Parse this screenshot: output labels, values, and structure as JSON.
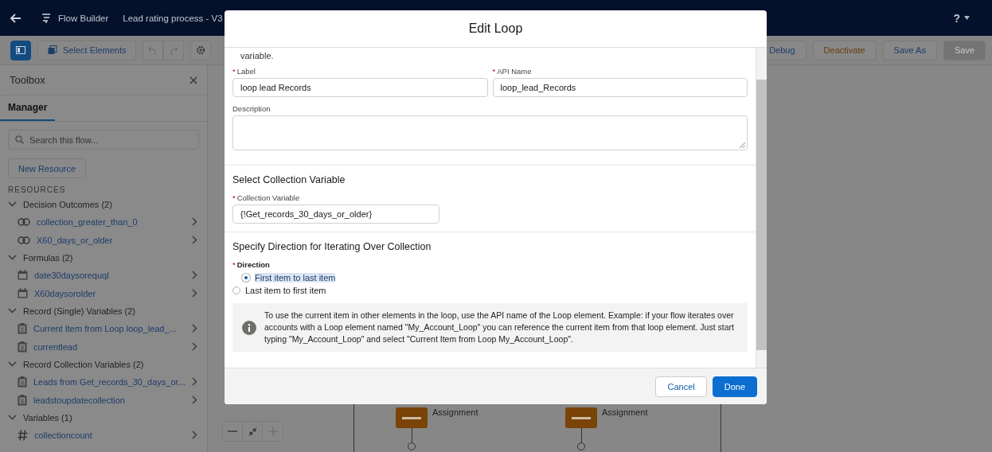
{
  "header": {
    "app_title": "Flow Builder",
    "flow_name": "Lead rating process - V3",
    "help": "?"
  },
  "toolbar": {
    "select_elements": "Select Elements",
    "buttons": [
      {
        "label": "Debug",
        "kind": "normal",
        "disabled": false
      },
      {
        "label": "Deactivate",
        "kind": "warning",
        "disabled": false
      },
      {
        "label": "Save As",
        "kind": "normal",
        "disabled": false
      },
      {
        "label": "Save",
        "kind": "normal",
        "disabled": true
      }
    ]
  },
  "toolbox": {
    "title": "Toolbox",
    "tabs": [
      {
        "label": "Manager",
        "selected": true
      }
    ],
    "search": {
      "placeholder": "Search this flow..."
    },
    "new_resource": "New Resource",
    "section_heading": "RESOURCES",
    "groups": [
      {
        "label": "Decision Outcomes (2)",
        "expanded": true,
        "children": [
          {
            "label": "collection_greater_than_0",
            "kind": "outcome"
          },
          {
            "label": "X60_days_or_older",
            "kind": "outcome"
          }
        ]
      },
      {
        "label": "Formulas (2)",
        "expanded": true,
        "children": [
          {
            "label": "date30daysorequql",
            "kind": "formula"
          },
          {
            "label": "X60daysorolder",
            "kind": "formula"
          }
        ]
      },
      {
        "label": "Record (Single) Variables (2)",
        "expanded": true,
        "children": [
          {
            "label": "Current Item from Loop loop_lead_...",
            "kind": "record"
          },
          {
            "label": "currentlead",
            "kind": "record"
          }
        ]
      },
      {
        "label": "Record Collection Variables (2)",
        "expanded": true,
        "children": [
          {
            "label": "Leads from Get_records_30_days_or...",
            "kind": "record"
          },
          {
            "label": "leadstoupdatecollection",
            "kind": "record"
          }
        ]
      },
      {
        "label": "Variables (1)",
        "expanded": true,
        "children": [
          {
            "label": "collectioncount",
            "kind": "number"
          }
        ]
      }
    ]
  },
  "canvas": {
    "nodes": [
      {
        "label": "Assignment"
      },
      {
        "label": "Assignment"
      }
    ]
  },
  "modal": {
    "title": "Edit Loop",
    "intro": "variable.",
    "label_field": {
      "required_mark": "*",
      "label": "Label",
      "value": "loop lead Records"
    },
    "api_name_field": {
      "required_mark": "*",
      "label": "API Name",
      "value": "loop_lead_Records"
    },
    "description_field": {
      "label": "Description"
    },
    "collection_section": {
      "heading": "Select Collection Variable",
      "field": {
        "required_mark": "*",
        "label": "Collection Variable",
        "value": "{!Get_records_30_days_or_older}"
      }
    },
    "direction_section": {
      "heading": "Specify Direction for Iterating Over Collection",
      "required_mark": "*",
      "label": "Direction",
      "options": [
        {
          "label": "First item to last item",
          "selected": true
        },
        {
          "label": "Last item to first item",
          "selected": false
        }
      ]
    },
    "info": "To use the current item in other elements in the loop, use the API name of the Loop element. Example: if your flow iterates over accounts with a Loop element named \"My_Account_Loop\" you can reference the current item from that loop element. Just start typing \"My_Account_Loop\" and select \"Current Item from Loop My_Account_Loop\".",
    "cancel": "Cancel",
    "done": "Done"
  }
}
